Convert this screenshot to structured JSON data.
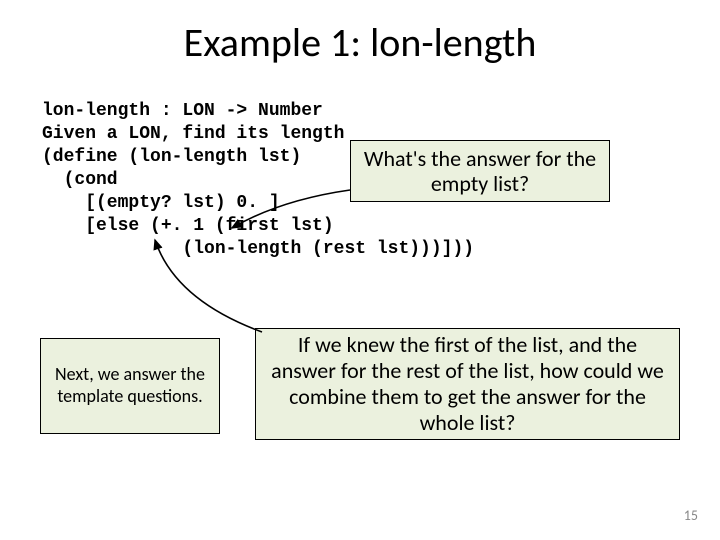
{
  "title": "Example 1: lon-length",
  "code": "lon-length : LON -> Number\nGiven a LON, find its length\n(define (lon-length lst)\n  (cond\n    [(empty? lst) 0. ]\n    [else (+. 1 (first lst)\n             (lon-length (rest lst)))]))",
  "callout_top_right": "What's the answer for the empty list?",
  "callout_bottom_left": "Next, we answer the template questions.",
  "callout_bottom_right": "If we knew the first of the list, and the answer for the rest of the list, how could we combine them to get the answer for the whole list?",
  "pagenum": "15"
}
